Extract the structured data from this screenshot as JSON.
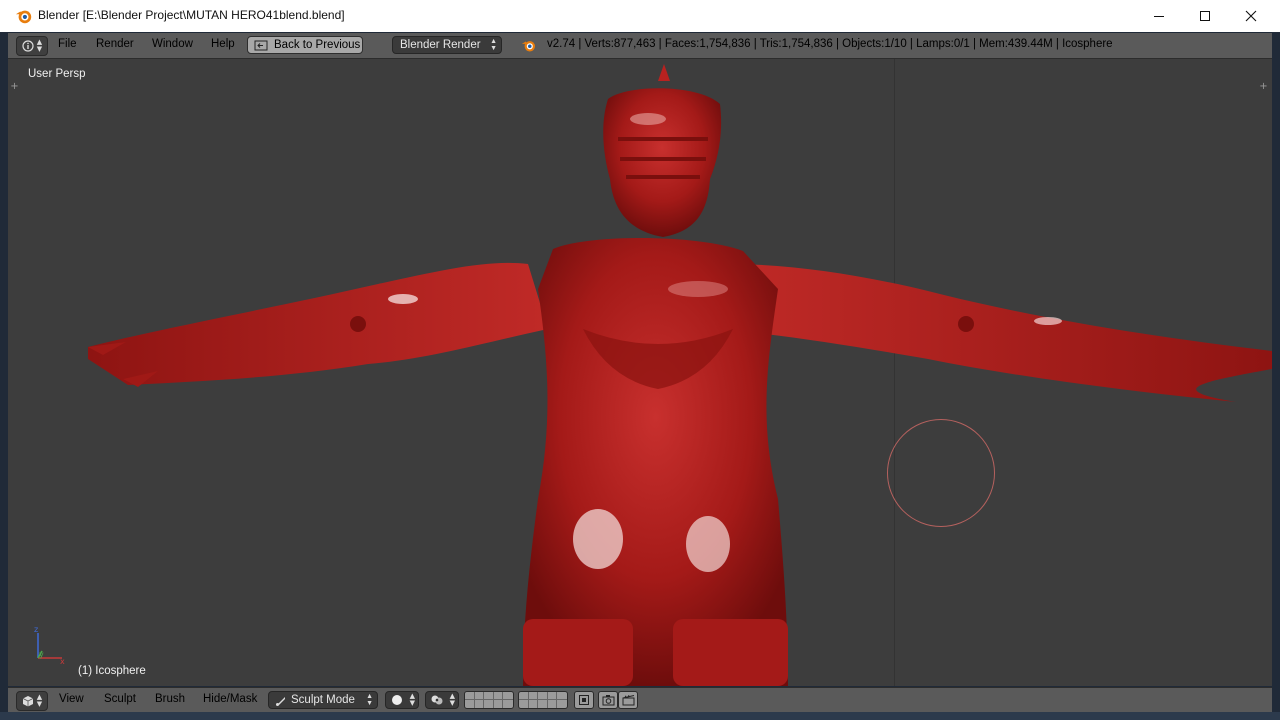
{
  "window": {
    "title": "Blender [E:\\Blender Project\\MUTAN HERO41blend.blend]",
    "icon": "blender-logo-icon",
    "controls": [
      "minimize-icon",
      "maximize-icon",
      "close-icon"
    ]
  },
  "info_header": {
    "menus": [
      "File",
      "Render",
      "Window",
      "Help"
    ],
    "back_button": "Back to Previous",
    "render_engine": "Blender Render",
    "stats": "v2.74 | Verts:877,463 | Faces:1,754,836 | Tris:1,754,836 | Objects:1/10 | Lamps:0/1 | Mem:439.44M | Icosphere"
  },
  "viewport": {
    "view_label": "User Persp",
    "object_label": "(1) Icosphere",
    "model_color": "#b01c1c",
    "background_color": "#3d3d3d",
    "brush_circle_color": "#b5615e"
  },
  "view3d_header": {
    "menus": [
      "View",
      "Sculpt",
      "Brush",
      "Hide/Mask"
    ],
    "mode": "Sculpt Mode"
  },
  "colors": {
    "header_bg": "#5a5a5a",
    "frame_bg": "#202a38"
  }
}
